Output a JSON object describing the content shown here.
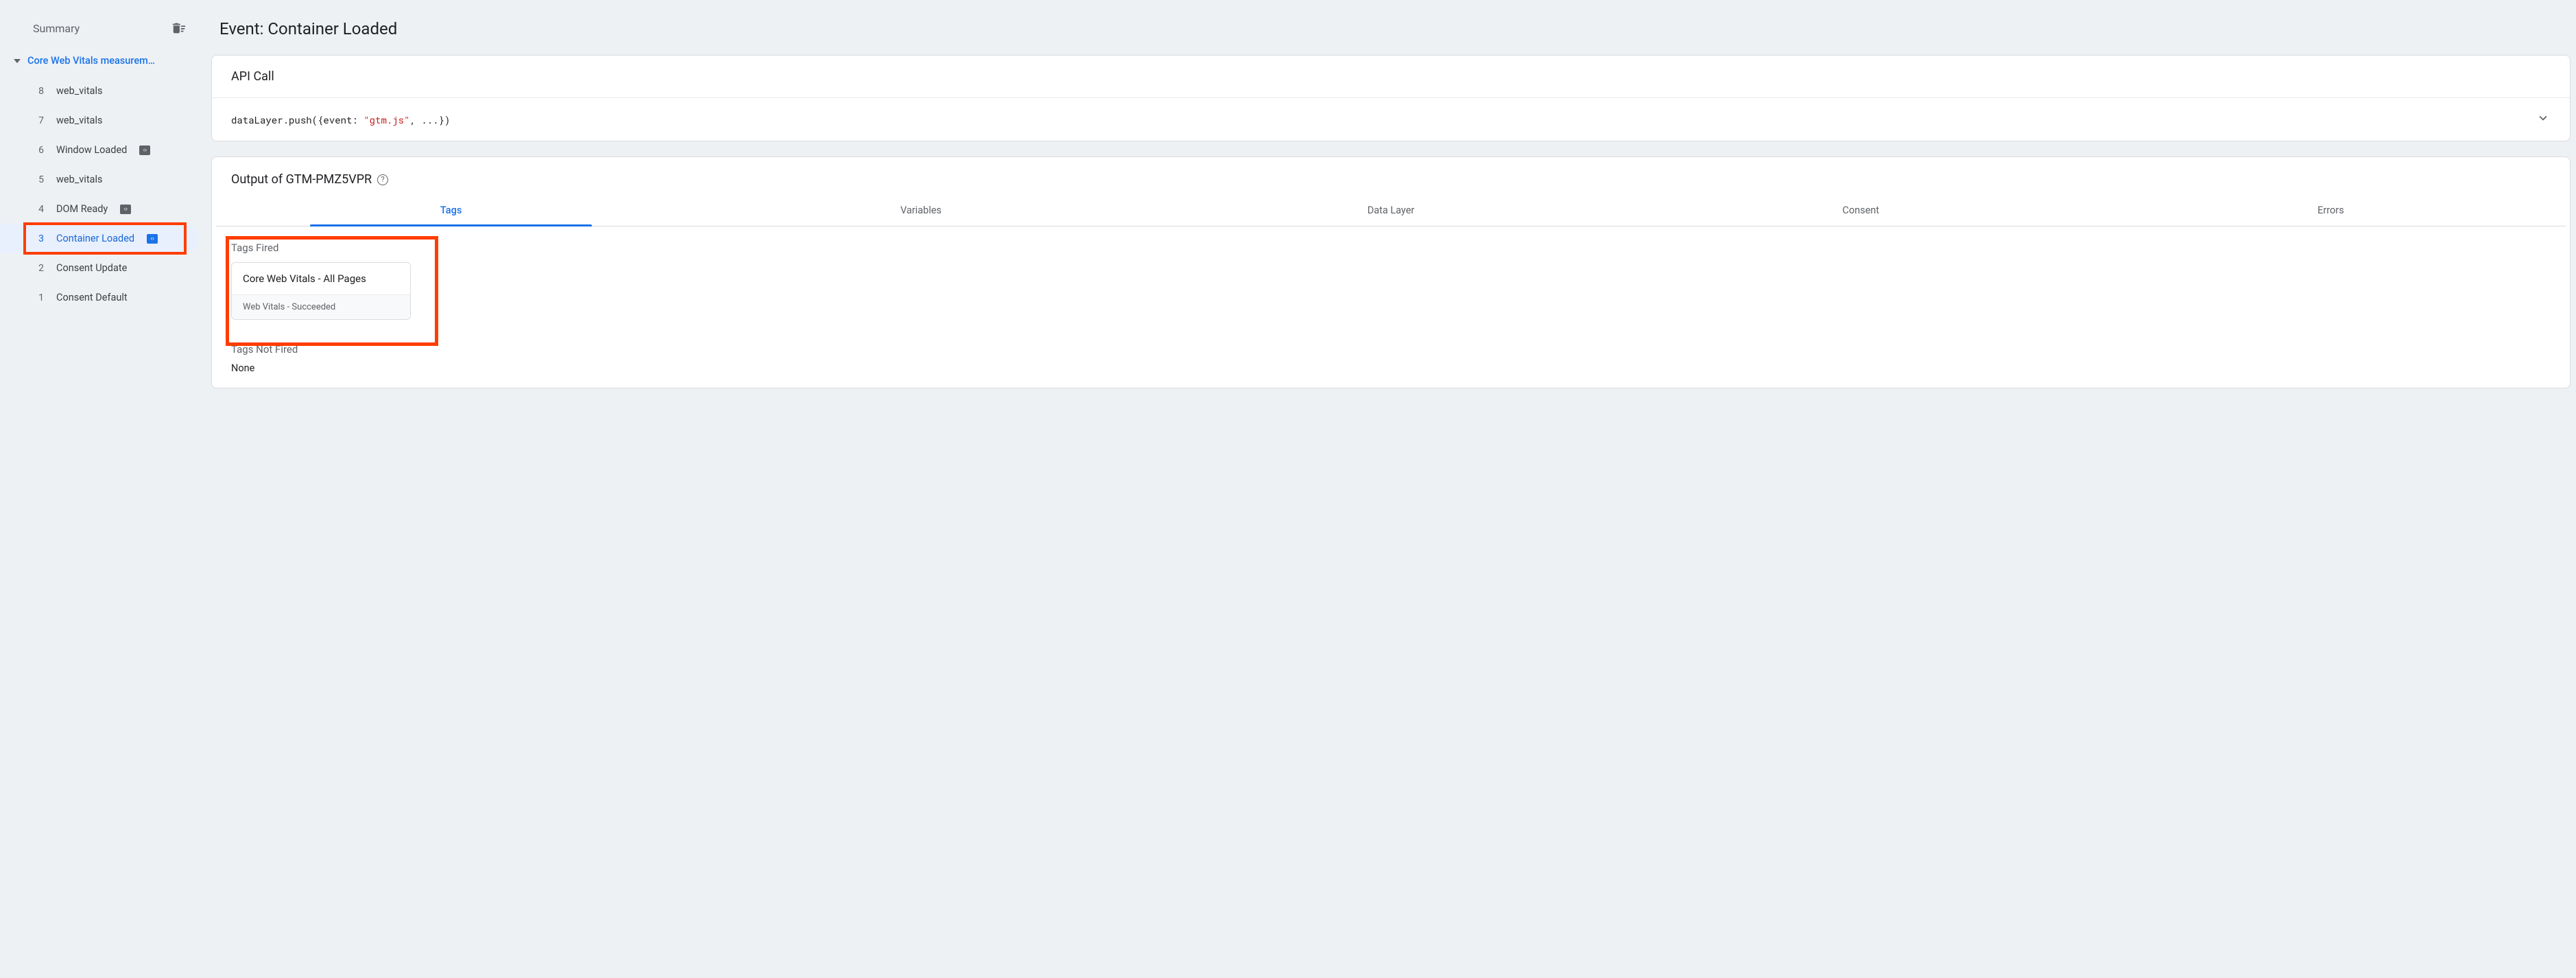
{
  "sidebar": {
    "header_title": "Summary",
    "group_title": "Core Web Vitals measurem…",
    "events": [
      {
        "num": "8",
        "label": "web_vitals",
        "has_badge": false,
        "active": false
      },
      {
        "num": "7",
        "label": "web_vitals",
        "has_badge": false,
        "active": false
      },
      {
        "num": "6",
        "label": "Window Loaded",
        "has_badge": true,
        "active": false
      },
      {
        "num": "5",
        "label": "web_vitals",
        "has_badge": false,
        "active": false
      },
      {
        "num": "4",
        "label": "DOM Ready",
        "has_badge": true,
        "active": false
      },
      {
        "num": "3",
        "label": "Container Loaded",
        "has_badge": true,
        "active": true
      },
      {
        "num": "2",
        "label": "Consent Update",
        "has_badge": false,
        "active": false
      },
      {
        "num": "1",
        "label": "Consent Default",
        "has_badge": false,
        "active": false
      }
    ]
  },
  "page": {
    "title": "Event: Container Loaded"
  },
  "api_call": {
    "header": "API Call",
    "code_pre": "dataLayer.push({event: ",
    "code_str": "\"gtm.js\"",
    "code_post": ", ...})"
  },
  "output": {
    "title": "Output of GTM-PMZ5VPR",
    "tabs": [
      "Tags",
      "Variables",
      "Data Layer",
      "Consent",
      "Errors"
    ],
    "active_tab": 0,
    "tags_fired_label": "Tags Fired",
    "tags_not_fired_label": "Tags Not Fired",
    "none_text": "None",
    "fired_tags": [
      {
        "title": "Core Web Vitals - All Pages",
        "sub": "Web Vitals - Succeeded"
      }
    ]
  }
}
